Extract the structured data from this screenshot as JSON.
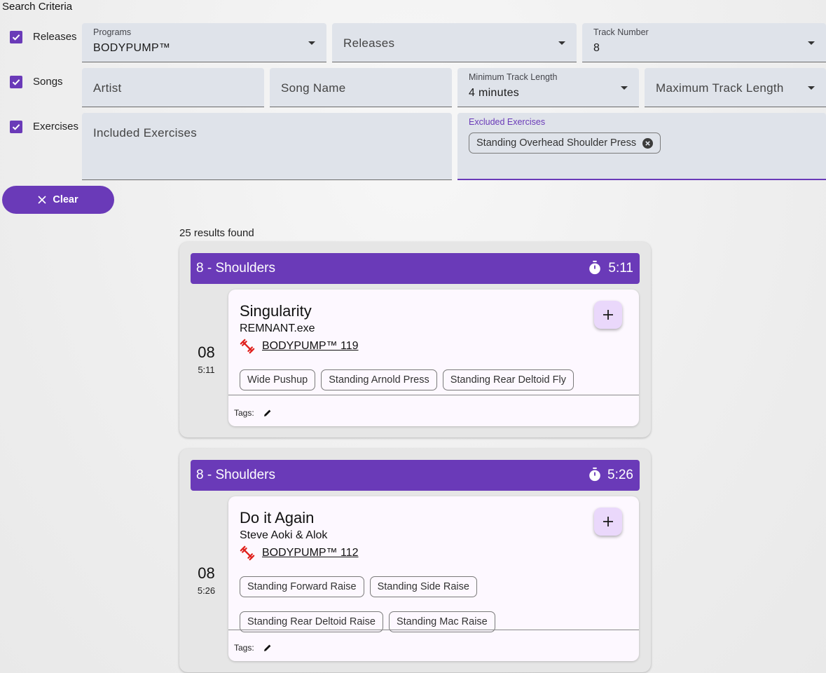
{
  "header": {
    "title": "Search Criteria"
  },
  "criteria": {
    "releases_row": {
      "label": "Releases",
      "programs": {
        "label": "Programs",
        "value": "BODYPUMP™"
      },
      "releases": {
        "placeholder": "Releases"
      },
      "track_number": {
        "label": "Track Number",
        "value": "8"
      }
    },
    "songs_row": {
      "label": "Songs",
      "artist": {
        "placeholder": "Artist"
      },
      "song_name": {
        "placeholder": "Song Name"
      },
      "min_length": {
        "label": "Minimum Track Length",
        "value": "4 minutes"
      },
      "max_length": {
        "placeholder": "Maximum Track Length"
      }
    },
    "exercises_row": {
      "label": "Exercises",
      "included": {
        "placeholder": "Included Exercises"
      },
      "excluded": {
        "label": "Excluded Exercises",
        "chips": [
          "Standing Overhead Shoulder Press"
        ]
      }
    }
  },
  "clear_button": {
    "label": "Clear"
  },
  "results": {
    "count_text": "25 results found",
    "cards": [
      {
        "header": "8 - Shoulders",
        "duration": "5:11",
        "track_number": "08",
        "track_length": "5:11",
        "song": "Singularity",
        "artist": "REMNANT.exe",
        "release": "BODYPUMP™ 119",
        "exercises": [
          "Wide Pushup",
          "Standing Arnold Press",
          "Standing Rear Deltoid Fly"
        ],
        "tags_label": "Tags:"
      },
      {
        "header": "8 - Shoulders",
        "duration": "5:26",
        "track_number": "08",
        "track_length": "5:26",
        "song": "Do it Again",
        "artist": "Steve Aoki & Alok",
        "release": "BODYPUMP™ 112",
        "exercises": [
          "Standing Forward Raise",
          "Standing Side Raise",
          "Standing Rear Deltoid Raise",
          "Standing Mac Raise"
        ],
        "tags_label": "Tags:"
      }
    ]
  },
  "colors": {
    "accent": "#6a3ab8",
    "field_bg": "#dfe3ea",
    "card_bg": "#fdf8ff",
    "add_button_bg": "#ead8fb",
    "release_icon": "#e0201c"
  },
  "icons": {
    "checkbox": "check-icon",
    "dropdown": "caret-down-icon",
    "chip_remove": "cancel-circle-icon",
    "clear": "close-icon",
    "timer": "stopwatch-icon",
    "add": "plus-icon",
    "release": "dumbbell-icon",
    "edit": "pencil-icon"
  }
}
